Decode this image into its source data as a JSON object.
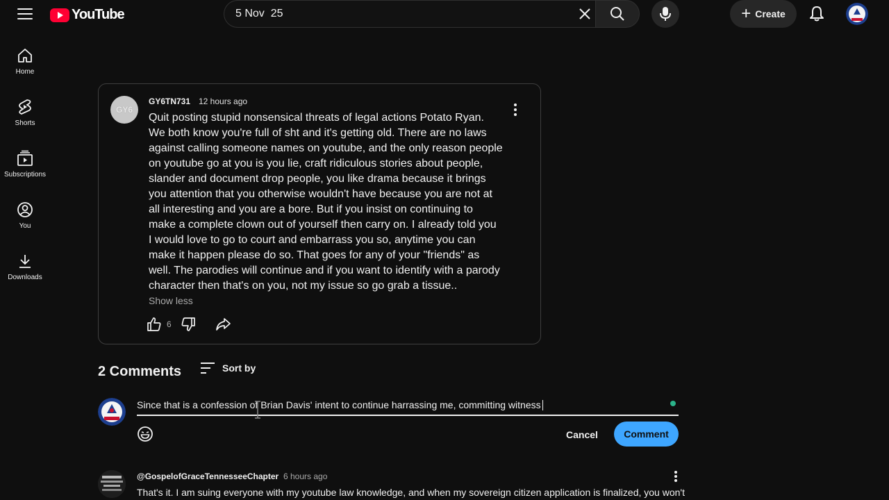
{
  "header": {
    "logo_text": "YouTube",
    "search": {
      "value": "5 Nov  25",
      "placeholder": "Search"
    },
    "create_label": "Create"
  },
  "sidebar": {
    "items": [
      {
        "label": "Home",
        "icon": "home-icon"
      },
      {
        "label": "Shorts",
        "icon": "shorts-icon"
      },
      {
        "label": "Subscriptions",
        "icon": "subscriptions-icon"
      },
      {
        "label": "You",
        "icon": "account-icon"
      },
      {
        "label": "Downloads",
        "icon": "download-icon"
      }
    ]
  },
  "post": {
    "avatar_text": "GY6",
    "author": "GY6TN731",
    "time": "12 hours ago",
    "body": "Quit posting stupid nonsensical threats of legal actions Potato Ryan.\nWe both know you're full of sht and it's getting old.  There are no laws\nagainst calling someone names on youtube, and the only reason people\non youtube go at you is you lie, craft ridiculous stories about people,\nslander and document drop people, you like drama because it brings\nyou attention that you otherwise wouldn't have because you are not at\nall interesting and you are a bore. But if you insist on continuing to\nmake a complete clown out of yourself then carry on. I already told you\nI would love to go to court and embarrass you so, anytime you can\nmake it happen please do so. That goes for any of your \"friends\" as\nwell. The parodies will continue and if you want to identify with a parody\ncharacter then that's on you, not my issue so go grab a tissue..",
    "show_less": "Show less",
    "likes": "6"
  },
  "comments": {
    "count_label": "2 Comments",
    "sort_label": "Sort by",
    "draft": "Since that is a confession of Brian Davis' intent to continue harrassing me, committing witness",
    "cancel_label": "Cancel",
    "submit_label": "Comment",
    "items": [
      {
        "author": "@GospelofGraceTennesseeChapter",
        "time": "6 hours ago",
        "text": "That's it. I am suing everyone with my youtube law knowledge, and when my sovereign citizen application is finalized, you won't"
      }
    ]
  },
  "colors": {
    "background": "#0f0f0f",
    "accent_blue": "#3ea6ff",
    "brand_red": "#ff0033"
  }
}
